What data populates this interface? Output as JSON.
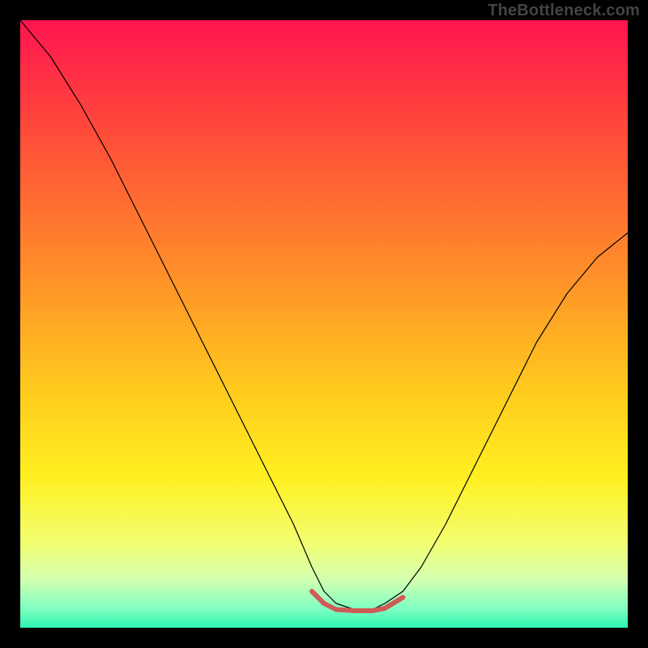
{
  "watermark": "TheBottleneck.com",
  "chart_data": {
    "type": "line",
    "title": "",
    "xlabel": "",
    "ylabel": "",
    "xlim": [
      0,
      100
    ],
    "ylim": [
      0,
      100
    ],
    "axes_visible": false,
    "background": {
      "type": "vertical-gradient",
      "stops": [
        {
          "pos": 0.0,
          "color": "#ff1450"
        },
        {
          "pos": 0.18,
          "color": "#ff4a3a"
        },
        {
          "pos": 0.4,
          "color": "#ff8a2a"
        },
        {
          "pos": 0.6,
          "color": "#ffc81e"
        },
        {
          "pos": 0.75,
          "color": "#ffef20"
        },
        {
          "pos": 0.86,
          "color": "#f2ff70"
        },
        {
          "pos": 0.92,
          "color": "#d4ffb0"
        },
        {
          "pos": 0.97,
          "color": "#7dffc2"
        },
        {
          "pos": 1.0,
          "color": "#2cf5b0"
        }
      ]
    },
    "series": [
      {
        "name": "bottleneck-curve",
        "color": "#000000",
        "width": 1.2,
        "x": [
          0,
          5,
          10,
          15,
          20,
          25,
          30,
          35,
          40,
          45,
          48,
          50,
          52,
          55,
          58,
          60,
          63,
          66,
          70,
          75,
          80,
          85,
          90,
          95,
          100
        ],
        "y": [
          100,
          94,
          86,
          77,
          67,
          57,
          47,
          37,
          27,
          17,
          10,
          6,
          4,
          3,
          3,
          4,
          6,
          10,
          17,
          27,
          37,
          47,
          55,
          61,
          65
        ]
      },
      {
        "name": "bottom-highlight",
        "color": "#cf5b56",
        "width": 6,
        "x": [
          48,
          50,
          52,
          55,
          58,
          60,
          63
        ],
        "y": [
          6,
          4,
          3,
          2.8,
          2.8,
          3.2,
          5
        ]
      }
    ]
  }
}
